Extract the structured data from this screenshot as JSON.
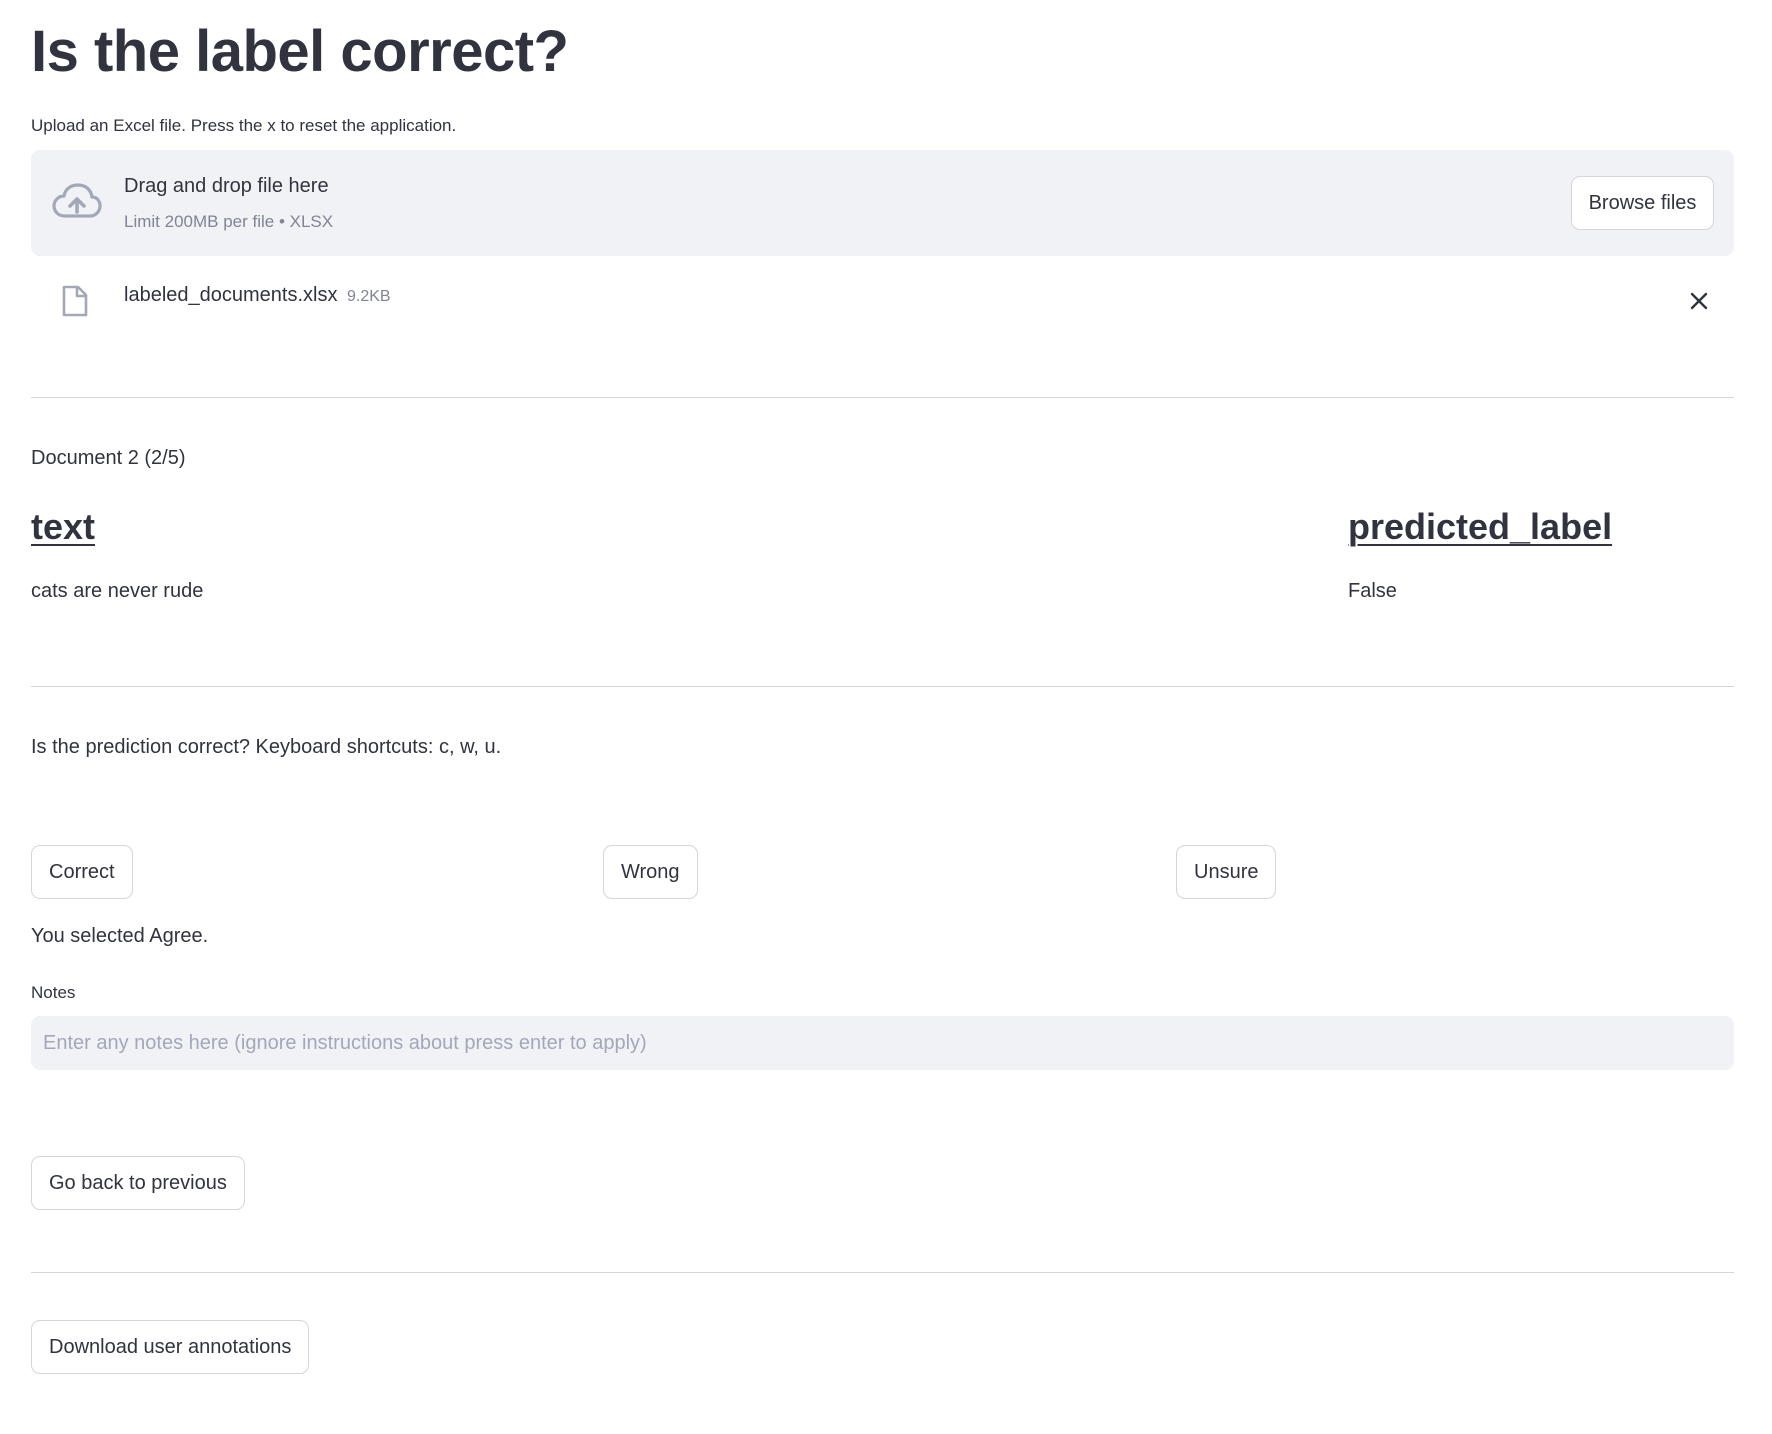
{
  "page": {
    "title": "Is the label correct?"
  },
  "uploader": {
    "label": "Upload an Excel file. Press the x to reset the application.",
    "dropzone_title": "Drag and drop file here",
    "dropzone_limit": "Limit 200MB per file • XLSX",
    "browse_label": "Browse files",
    "icon": "cloud-upload-icon"
  },
  "uploaded_file": {
    "name": "labeled_documents.xlsx",
    "size": "9.2KB",
    "icon": "file-icon",
    "remove_icon": "close-icon"
  },
  "document": {
    "counter": "Document 2 (2/5)",
    "columns": [
      {
        "header": "text",
        "value": "cats are never rude"
      },
      {
        "header": "predicted_label",
        "value": "False"
      }
    ]
  },
  "review": {
    "prompt": "Is the prediction correct? Keyboard shortcuts: c, w, u.",
    "choices": [
      {
        "label": "Correct"
      },
      {
        "label": "Wrong"
      },
      {
        "label": "Unsure"
      }
    ],
    "selected_text": "You selected Agree."
  },
  "notes": {
    "label": "Notes",
    "value": "",
    "placeholder": "Enter any notes here (ignore instructions about press enter to apply)"
  },
  "actions": {
    "back_label": "Go back to previous",
    "download_label": "Download user annotations"
  },
  "colors": {
    "text": "#31333f",
    "muted": "#808495",
    "surface": "#f0f2f6",
    "border": "#d6d6d9",
    "icon": "#a3a8b8"
  }
}
